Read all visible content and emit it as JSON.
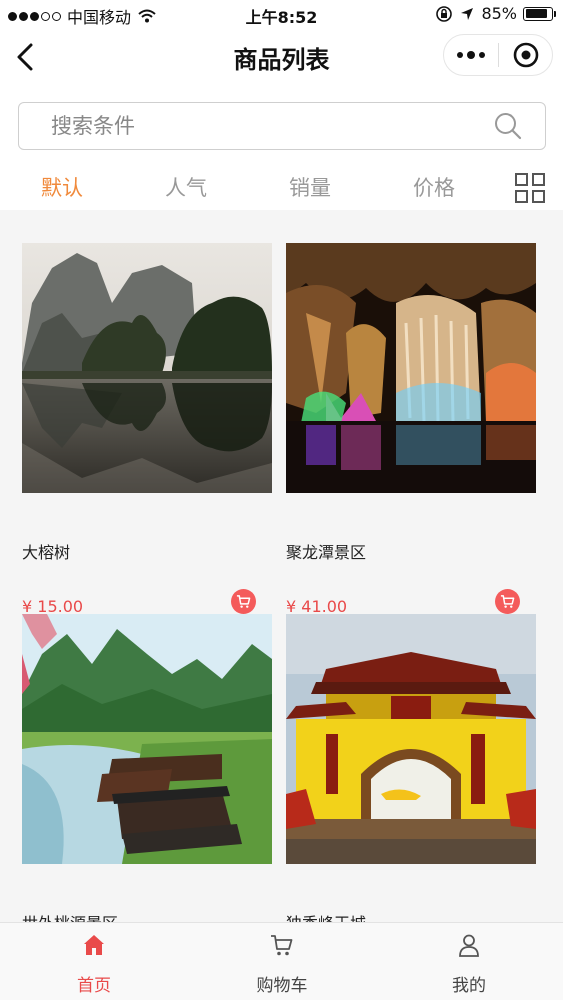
{
  "status_bar": {
    "carrier": "中国移动",
    "time": "上午8:52",
    "battery": "85%",
    "battery_level": 0.85
  },
  "nav": {
    "title": "商品列表"
  },
  "search": {
    "placeholder": "搜索条件",
    "value": ""
  },
  "tabs": [
    {
      "label": "默认",
      "active": true
    },
    {
      "label": "人气",
      "active": false
    },
    {
      "label": "销量",
      "active": false
    },
    {
      "label": "价格",
      "active": false
    }
  ],
  "products": [
    {
      "name": "大榕树",
      "price": "¥ 15.00",
      "image": "karst-river-landscape"
    },
    {
      "name": "聚龙潭景区",
      "price": "¥ 41.00",
      "image": "illuminated-cave"
    },
    {
      "name": "世外桃源景区",
      "price": "",
      "image": "village-mountains-river"
    },
    {
      "name": "独秀峰王城",
      "price": "",
      "image": "yellow-palace-gate"
    }
  ],
  "tab_bar": [
    {
      "label": "首页",
      "icon": "home-icon",
      "active": true
    },
    {
      "label": "购物车",
      "icon": "cart-icon",
      "active": false
    },
    {
      "label": "我的",
      "icon": "user-icon",
      "active": false
    }
  ],
  "colors": {
    "accent_orange": "#f08a3c",
    "price_red": "#e94a4a",
    "cart_button": "#f45b5b"
  }
}
